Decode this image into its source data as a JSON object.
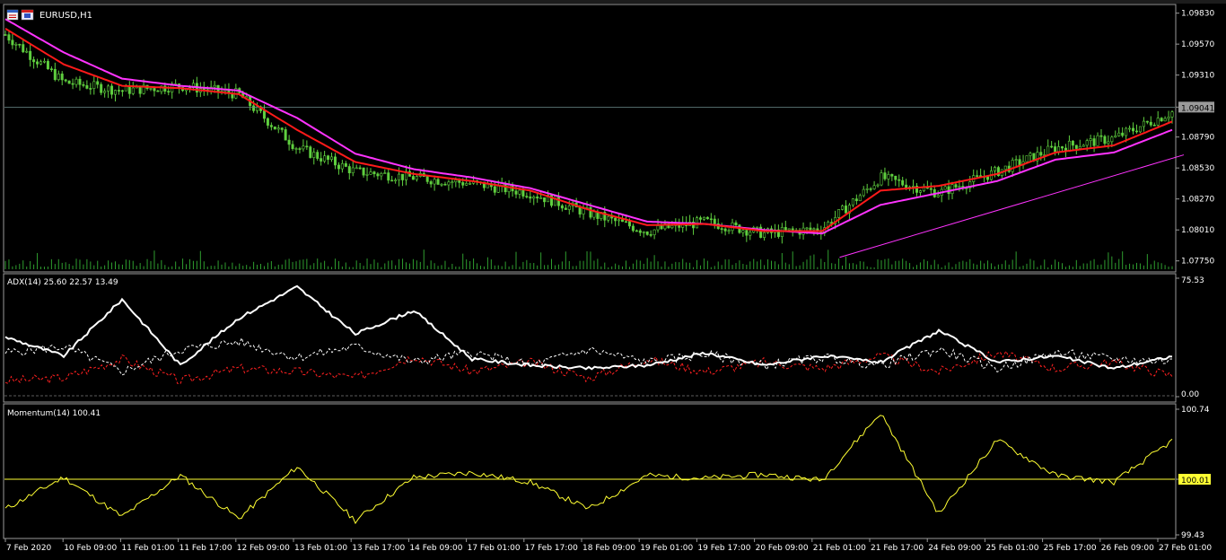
{
  "window": {
    "symbol_title": "EURUSD,H1",
    "icons": [
      "chart-window-icon",
      "symbol-icon"
    ]
  },
  "colors": {
    "background": "#000000",
    "frame": "#9a9a9a",
    "bull_candle": "#5fcf3f",
    "ema_fast": "#ff1a1a",
    "ema_slow": "#ff33ff",
    "adx_main": "#ffffff",
    "di_plus": "#ffffff",
    "di_minus": "#ff2020",
    "momentum": "#ffff33",
    "volume": "#2f9e2f",
    "price_marker": "#9a9a9a"
  },
  "chart_data": [
    {
      "type": "line",
      "title": "EURUSD,H1",
      "y_ticks": [
        "1.09830",
        "1.09570",
        "1.09310",
        "1.09041",
        "1.08790",
        "1.08530",
        "1.08270",
        "1.08010",
        "1.07750"
      ],
      "ylim": [
        1.0768,
        1.0988
      ],
      "current_price": "1.09041",
      "x_tick_labels": [
        "7 Feb 2020",
        "10 Feb 09:00",
        "11 Feb 01:00",
        "11 Feb 17:00",
        "12 Feb 09:00",
        "13 Feb 01:00",
        "13 Feb 17:00",
        "14 Feb 09:00",
        "17 Feb 01:00",
        "17 Feb 17:00",
        "18 Feb 09:00",
        "19 Feb 01:00",
        "19 Feb 17:00",
        "20 Feb 09:00",
        "21 Feb 01:00",
        "21 Feb 17:00",
        "24 Feb 09:00",
        "25 Feb 01:00",
        "25 Feb 17:00",
        "26 Feb 09:00",
        "27 Feb 01:00"
      ],
      "series": [
        {
          "name": "close",
          "x": [
            0,
            1,
            2,
            3,
            4,
            5,
            6,
            7,
            8,
            9,
            10,
            11,
            12,
            13,
            14,
            15,
            16,
            17,
            18,
            19,
            20
          ],
          "values": [
            1.0965,
            1.0925,
            1.0918,
            1.0922,
            1.0915,
            1.087,
            1.085,
            1.0845,
            1.084,
            1.0832,
            1.0815,
            1.08,
            1.0808,
            1.0798,
            1.0802,
            1.0845,
            1.0832,
            1.085,
            1.087,
            1.0878,
            1.09
          ]
        },
        {
          "name": "ema_fast",
          "x": [
            0,
            1,
            2,
            3,
            4,
            5,
            6,
            7,
            8,
            9,
            10,
            11,
            12,
            13,
            14,
            15,
            16,
            17,
            18,
            19,
            20
          ],
          "values": [
            1.097,
            1.094,
            1.0922,
            1.092,
            1.0915,
            1.0885,
            1.0858,
            1.0848,
            1.0842,
            1.0834,
            1.0818,
            1.0805,
            1.0806,
            1.08,
            1.08,
            1.0834,
            1.0838,
            1.0848,
            1.0866,
            1.0872,
            1.0892
          ]
        },
        {
          "name": "ema_slow",
          "x": [
            0,
            1,
            2,
            3,
            4,
            5,
            6,
            7,
            8,
            9,
            10,
            11,
            12,
            13,
            14,
            15,
            16,
            17,
            18,
            19,
            20
          ],
          "values": [
            1.0978,
            1.095,
            1.0928,
            1.0922,
            1.0918,
            1.0895,
            1.0865,
            1.0852,
            1.0845,
            1.0836,
            1.0822,
            1.0808,
            1.0806,
            1.0801,
            1.0798,
            1.0822,
            1.0832,
            1.0842,
            1.086,
            1.0866,
            1.0885
          ]
        },
        {
          "name": "trendline",
          "x": [
            14.3,
            20.2
          ],
          "values": [
            1.0778,
            1.0864
          ]
        }
      ]
    },
    {
      "type": "line",
      "title": "ADX(14) 25.60 22.57 13.49",
      "y_ticks": [
        "75.53",
        "0.00"
      ],
      "ylim": [
        0,
        75.53
      ],
      "series": [
        {
          "name": "ADX",
          "x": [
            0,
            1,
            2,
            3,
            4,
            5,
            6,
            7,
            8,
            9,
            10,
            11,
            12,
            13,
            14,
            15,
            16,
            17,
            18,
            19,
            20
          ],
          "values": [
            38,
            26,
            62,
            20,
            50,
            70,
            40,
            55,
            24,
            20,
            18,
            20,
            28,
            20,
            26,
            22,
            42,
            22,
            26,
            18,
            25.6
          ]
        },
        {
          "name": "+DI",
          "x": [
            0,
            1,
            2,
            3,
            4,
            5,
            6,
            7,
            8,
            9,
            10,
            11,
            12,
            13,
            14,
            15,
            16,
            17,
            18,
            19,
            20
          ],
          "values": [
            28,
            32,
            16,
            30,
            35,
            25,
            32,
            22,
            28,
            20,
            30,
            22,
            27,
            20,
            25,
            20,
            30,
            18,
            28,
            24,
            22.57
          ]
        },
        {
          "name": "-DI",
          "x": [
            0,
            1,
            2,
            3,
            4,
            5,
            6,
            7,
            8,
            9,
            10,
            11,
            12,
            13,
            14,
            15,
            16,
            17,
            18,
            19,
            20
          ],
          "values": [
            10,
            12,
            24,
            10,
            18,
            16,
            12,
            26,
            16,
            22,
            12,
            24,
            16,
            22,
            18,
            26,
            16,
            28,
            18,
            22,
            13.49
          ]
        }
      ]
    },
    {
      "type": "line",
      "title": "Momentum(14) 100.41",
      "y_ticks": [
        "100.74",
        "100.01",
        "99.43"
      ],
      "ylim": [
        99.43,
        100.74
      ],
      "level": "100.01",
      "series": [
        {
          "name": "Momentum",
          "x": [
            0,
            1,
            2,
            3,
            4,
            5,
            6,
            7,
            8,
            9,
            10,
            11,
            12,
            13,
            14,
            15,
            16,
            17,
            18,
            19,
            20
          ],
          "values": [
            99.7,
            100.03,
            99.62,
            100.05,
            99.6,
            100.14,
            99.58,
            100.03,
            100.08,
            99.98,
            99.7,
            100.05,
            100.02,
            100.06,
            100.0,
            100.7,
            99.65,
            100.42,
            100.05,
            99.98,
            100.41
          ]
        }
      ]
    }
  ]
}
